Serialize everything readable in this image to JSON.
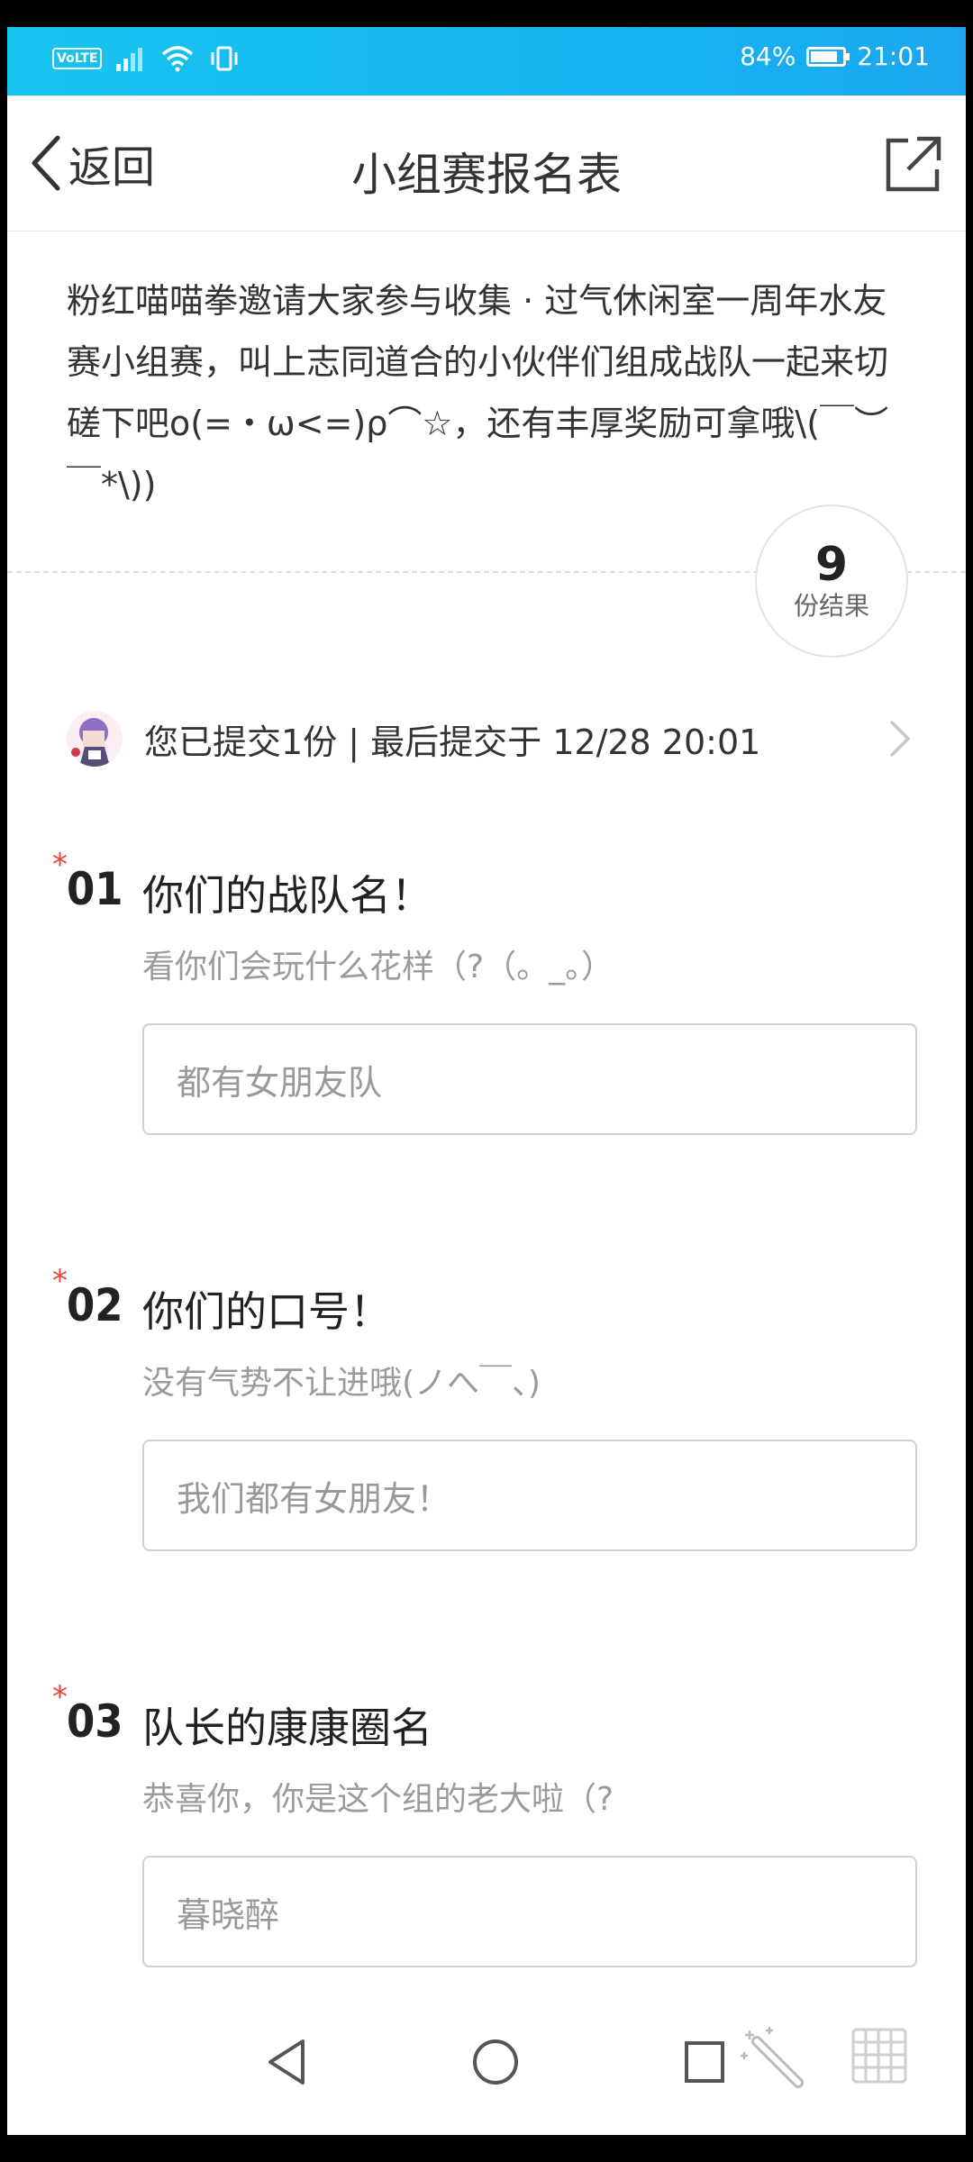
{
  "status_bar": {
    "network_badge": "VoLTE",
    "battery": "84%",
    "battery_level": 0.84,
    "time": "21:01"
  },
  "header": {
    "back_label": "返回",
    "title": "小组赛报名表"
  },
  "intro_text": "粉红喵喵拳邀请大家参与收集 · 过气休闲室一周年水友赛小组赛，叫上志同道合的小伙伴们组成战队一起来切磋下吧o(=・ω<=)ρ⌒☆，还有丰厚奖励可拿哦\\(￣︶￣*\\))",
  "results": {
    "count": "9",
    "label": "份结果"
  },
  "submission": {
    "text": "您已提交1份 | 最后提交于 12/28 20:01"
  },
  "questions": [
    {
      "number": "01",
      "required_mark": "*",
      "title": "你们的战队名！",
      "hint": "看你们会玩什么花样（?（。_。）",
      "value": "都有女朋友队"
    },
    {
      "number": "02",
      "required_mark": "*",
      "title": "你们的口号！",
      "hint": "没有气势不让进哦(ノへ￣、)",
      "value": "我们都有女朋友！"
    },
    {
      "number": "03",
      "required_mark": "*",
      "title": "队长的康康圈名",
      "hint": "恭喜你，你是这个组的老大啦（?",
      "value": "暮晓醉"
    }
  ],
  "nav_bar": {
    "icons": [
      "back-triangle-icon",
      "home-circle-icon",
      "recents-square-icon",
      "magic-wand-icon",
      "grid-icon"
    ]
  },
  "colors": {
    "status_bar": "#16b5f3",
    "required": "#e64340",
    "hint": "#9b9b9b"
  }
}
